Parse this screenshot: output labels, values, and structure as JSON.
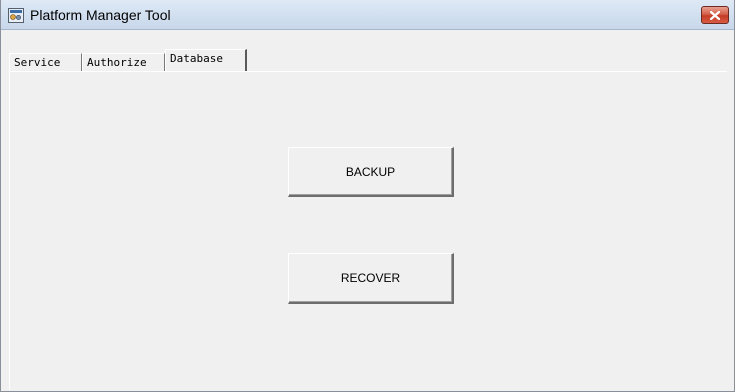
{
  "window": {
    "title": "Platform Manager Tool"
  },
  "tabs": [
    {
      "label": "Service"
    },
    {
      "label": "Authorize"
    },
    {
      "label": "Database"
    }
  ],
  "active_tab": "Database",
  "database": {
    "backup_label": "BACKUP",
    "recover_label": "RECOVER"
  },
  "colors": {
    "titlebar": "#d3e1f1",
    "close_button": "#c43c26",
    "window_bg": "#f0f0f0"
  }
}
